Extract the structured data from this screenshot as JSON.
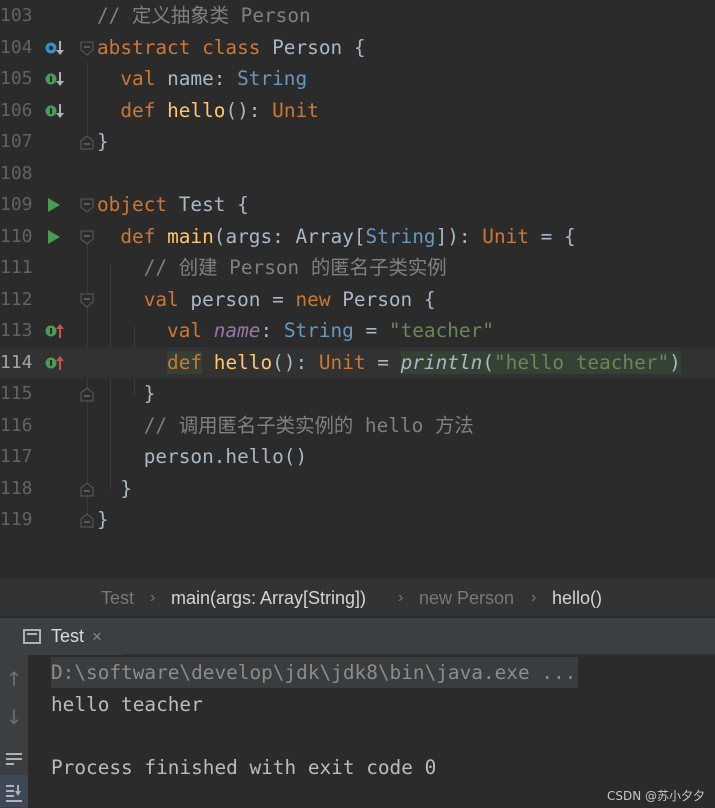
{
  "editor": {
    "lines": [
      {
        "num": "103",
        "tokens": [
          {
            "t": "// 定义抽象类 Person",
            "c": "cmt"
          }
        ]
      },
      {
        "num": "104",
        "tokens": [
          {
            "t": "abstract class ",
            "c": "kw"
          },
          {
            "t": "Person {",
            "c": ""
          }
        ]
      },
      {
        "num": "105",
        "tokens": [
          {
            "t": "  ",
            "c": ""
          },
          {
            "t": "val ",
            "c": "kw"
          },
          {
            "t": "name: ",
            "c": ""
          },
          {
            "t": "String",
            "c": "ty"
          }
        ]
      },
      {
        "num": "106",
        "tokens": [
          {
            "t": "  ",
            "c": ""
          },
          {
            "t": "def ",
            "c": "kw"
          },
          {
            "t": "hello",
            "c": "fn"
          },
          {
            "t": "(): ",
            "c": ""
          },
          {
            "t": "Unit",
            "c": "kw"
          }
        ]
      },
      {
        "num": "107",
        "tokens": [
          {
            "t": "}",
            "c": ""
          }
        ]
      },
      {
        "num": "108",
        "tokens": []
      },
      {
        "num": "109",
        "tokens": [
          {
            "t": "object ",
            "c": "kw"
          },
          {
            "t": "Test {",
            "c": ""
          }
        ]
      },
      {
        "num": "110",
        "tokens": [
          {
            "t": "  ",
            "c": ""
          },
          {
            "t": "def ",
            "c": "kw"
          },
          {
            "t": "main",
            "c": "fn"
          },
          {
            "t": "(args: Array[",
            "c": ""
          },
          {
            "t": "String",
            "c": "ty"
          },
          {
            "t": "]): ",
            "c": ""
          },
          {
            "t": "Unit",
            "c": "kw"
          },
          {
            "t": " = {",
            "c": ""
          }
        ]
      },
      {
        "num": "111",
        "tokens": [
          {
            "t": "    ",
            "c": ""
          },
          {
            "t": "// 创建 Person 的匿名子类实例",
            "c": "cmt"
          }
        ]
      },
      {
        "num": "112",
        "tokens": [
          {
            "t": "    ",
            "c": ""
          },
          {
            "t": "val ",
            "c": "kw"
          },
          {
            "t": "person = ",
            "c": ""
          },
          {
            "t": "new ",
            "c": "kw"
          },
          {
            "t": "Person {",
            "c": ""
          }
        ]
      },
      {
        "num": "113",
        "tokens": [
          {
            "t": "      ",
            "c": ""
          },
          {
            "t": "val ",
            "c": "kw"
          },
          {
            "t": "name",
            "c": "prop"
          },
          {
            "t": ": ",
            "c": ""
          },
          {
            "t": "String",
            "c": "ty"
          },
          {
            "t": " = ",
            "c": ""
          },
          {
            "t": "\"teacher\"",
            "c": "str"
          }
        ]
      },
      {
        "num": "114",
        "tokens": [
          {
            "t": "      ",
            "c": ""
          },
          {
            "t": "|",
            "c": "caret"
          },
          {
            "t": "def",
            "c": "kw hl"
          },
          {
            "t": " ",
            "c": ""
          },
          {
            "t": "hello",
            "c": "fn"
          },
          {
            "t": "(): ",
            "c": ""
          },
          {
            "t": "Unit",
            "c": "kw"
          },
          {
            "t": " = ",
            "c": ""
          },
          {
            "t": "println",
            "c": "callit hl"
          },
          {
            "t": "(",
            "c": "hl"
          },
          {
            "t": "\"hello teacher\"",
            "c": "str hl"
          },
          {
            "t": ")",
            "c": "hl"
          }
        ]
      },
      {
        "num": "115",
        "tokens": [
          {
            "t": "    }",
            "c": ""
          }
        ]
      },
      {
        "num": "116",
        "tokens": [
          {
            "t": "    ",
            "c": ""
          },
          {
            "t": "// 调用匿名子类实例的 hello 方法",
            "c": "cmt"
          }
        ]
      },
      {
        "num": "117",
        "tokens": [
          {
            "t": "    person.hello()",
            "c": ""
          }
        ]
      },
      {
        "num": "118",
        "tokens": [
          {
            "t": "  }",
            "c": ""
          }
        ]
      },
      {
        "num": "119",
        "tokens": [
          {
            "t": "}",
            "c": ""
          }
        ]
      }
    ],
    "current_line": "114"
  },
  "breadcrumb": {
    "items": [
      "Test",
      "main(args: Array[String])",
      "new Person",
      "hello()"
    ],
    "separator": "›"
  },
  "run_panel": {
    "tab_label": "Test",
    "tab_close": "×",
    "console": {
      "command": "D:\\software\\develop\\jdk\\jdk8\\bin\\java.exe ...",
      "output": "hello teacher",
      "exit": "Process finished with exit code 0"
    },
    "side_buttons": [
      "arrow-up-icon",
      "arrow-down-icon",
      "soft-wrap-icon",
      "scroll-to-end-icon"
    ]
  },
  "watermark": "CSDN @苏小夕夕",
  "colors": {
    "background": "#2b2b2b",
    "keyword": "#cc7832",
    "function": "#ffc66d",
    "type": "#6897bb",
    "string": "#6a8759",
    "comment": "#808080",
    "property": "#9876aa"
  }
}
